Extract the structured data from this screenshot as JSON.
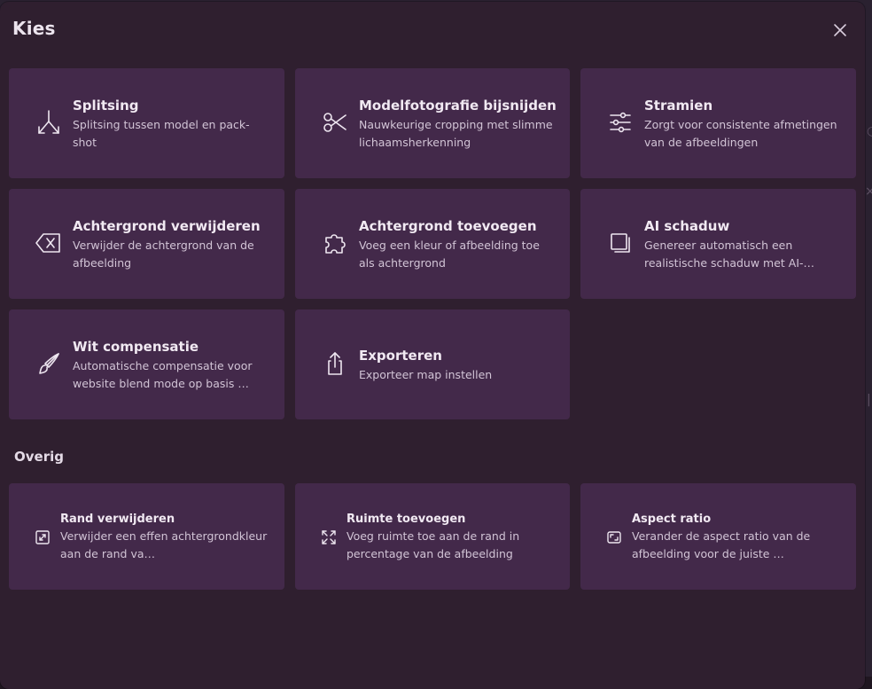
{
  "modal": {
    "title": "Kies",
    "close_icon": "close-icon"
  },
  "tools": [
    {
      "title": "Splitsing",
      "description": "Splitsing tussen model en pack-shot",
      "icon": "split-arrows-icon"
    },
    {
      "title": "Modelfotografie bijsnijden",
      "description": "Nauwkeurige cropping met slimme lichaamsherkenning",
      "icon": "scissors-icon"
    },
    {
      "title": "Stramien",
      "description": "Zorgt voor consistente afmetingen van de afbeeldingen",
      "icon": "sliders-icon"
    },
    {
      "title": "Achtergrond verwijderen",
      "description": "Verwijder de achtergrond van de afbeelding",
      "icon": "backspace-icon"
    },
    {
      "title": "Achtergrond toevoegen",
      "description": "Voeg een kleur of afbeelding toe als achtergrond",
      "icon": "puzzle-icon"
    },
    {
      "title": "AI schaduw",
      "description": "Genereer automatisch een realistische schaduw met AI-…",
      "icon": "shadow-square-icon"
    },
    {
      "title": "Wit compensatie",
      "description": "Automatische compensatie voor website blend mode op basis …",
      "icon": "brush-icon"
    },
    {
      "title": "Exporteren",
      "description": "Exporteer map instellen",
      "icon": "share-upload-icon"
    }
  ],
  "other_section": {
    "title": "Overig",
    "items": [
      {
        "title": "Rand verwijderen",
        "description": "Verwijder een effen achtergrondkleur aan de rand va…",
        "icon": "shrink-frame-icon"
      },
      {
        "title": "Ruimte toevoegen",
        "description": "Voeg ruimte toe aan de rand in percentage van de afbeelding",
        "icon": "expand-arrows-icon"
      },
      {
        "title": "Aspect ratio",
        "description": "Verander de aspect ratio van de afbeelding voor de juiste …",
        "icon": "aspect-ratio-icon"
      }
    ]
  },
  "colors": {
    "modal_bg": "#2f1f2f",
    "card_bg": "#43294a",
    "text_primary": "#f1e9f2",
    "text_secondary": "#d2c4d6"
  }
}
